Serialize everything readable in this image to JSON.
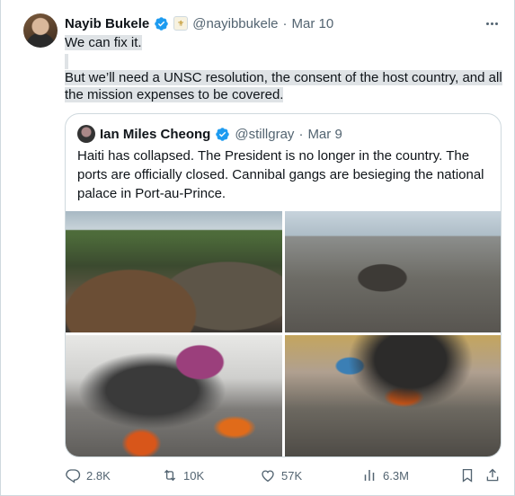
{
  "tweet": {
    "author_name": "Nayib Bukele",
    "handle": "@nayibbukele",
    "separator": "·",
    "date": "Mar 10",
    "text_line1": "We can fix it.",
    "text_line3": "But we’ll need a UNSC resolution, the consent of the host country, and all",
    "text_line4": "the mission expenses to be covered."
  },
  "quoted": {
    "author_name": "Ian Miles Cheong",
    "handle": "@stillgray",
    "separator": "·",
    "date": "Mar 9",
    "text": "Haiti has collapsed. The President is no longer in the country. The ports are officially closed. Cannibal gangs are besieging the national palace in Port-au-Prince."
  },
  "actions": {
    "replies": "2.8K",
    "reposts": "10K",
    "likes": "57K",
    "views": "6.3M"
  },
  "colors": {
    "verified": "#1d9bf0",
    "secondary_text": "#536471",
    "border": "#cfd9de",
    "highlight": "#dfe3e6"
  },
  "icons": [
    "verified-badge-icon",
    "government-badge-icon",
    "more-icon",
    "reply-icon",
    "repost-icon",
    "like-icon",
    "views-icon",
    "bookmark-icon",
    "share-icon"
  ]
}
